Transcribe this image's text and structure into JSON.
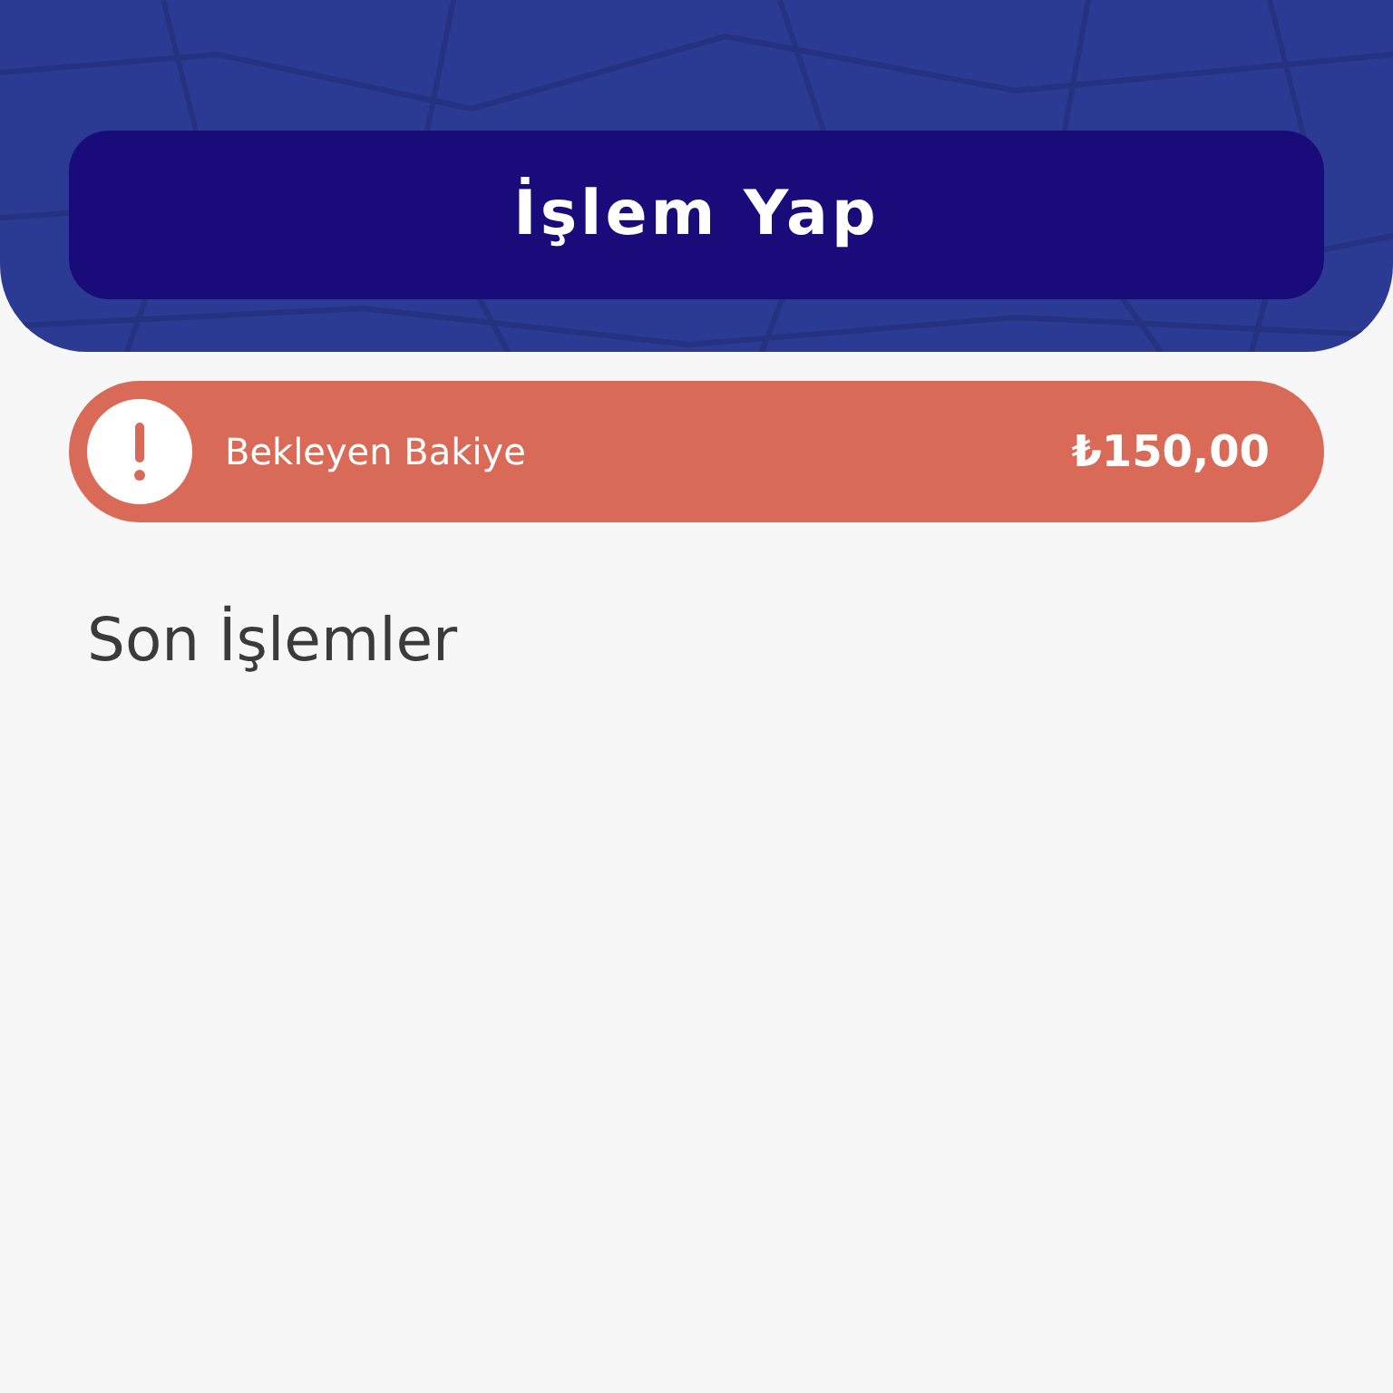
{
  "header": {
    "action_button": "İşlem Yap"
  },
  "pending_balance": {
    "label": "Bekleyen Bakiye",
    "amount": "₺150,00"
  },
  "recent_transactions": {
    "title": "Son İşlemler"
  }
}
